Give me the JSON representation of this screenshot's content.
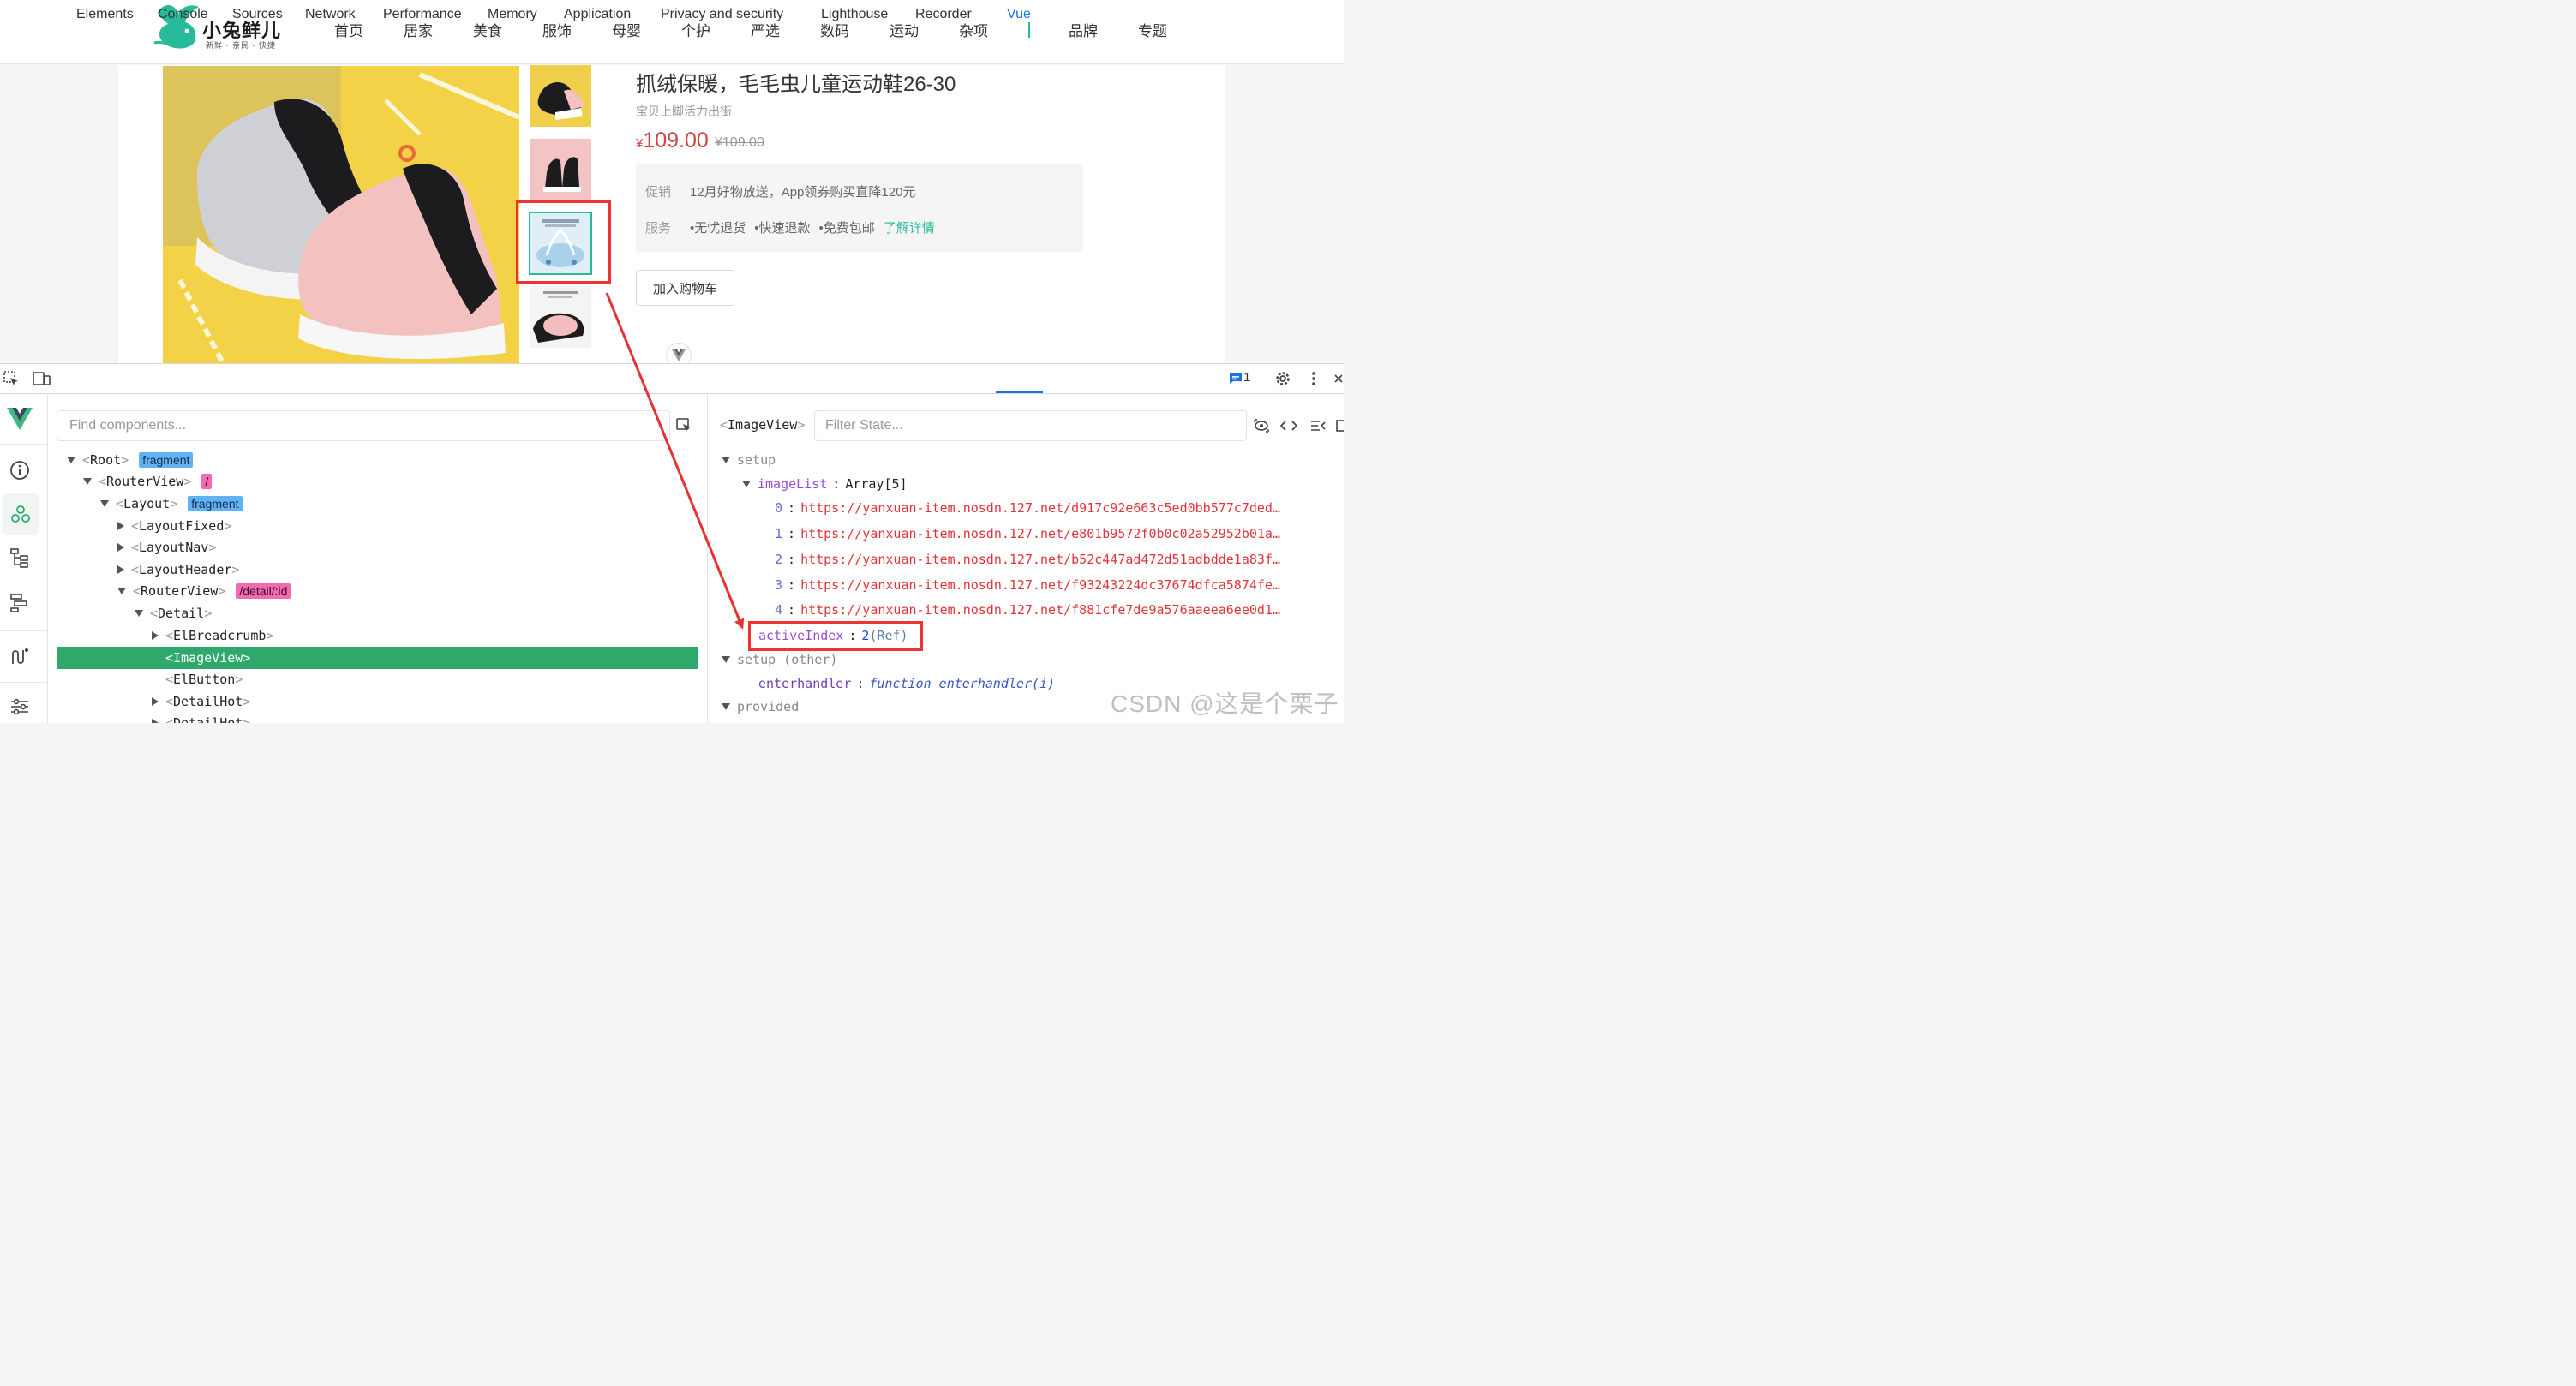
{
  "site": {
    "logo_text": "小兔鲜儿",
    "logo_sub": "新鲜 · 亲民 · 快捷",
    "nav": [
      "首页",
      "居家",
      "美食",
      "服饰",
      "母婴",
      "个护",
      "严选",
      "数码",
      "运动",
      "杂项"
    ],
    "nav_after": [
      "品牌",
      "专题"
    ]
  },
  "product": {
    "title": "抓绒保暖，毛毛虫儿童运动鞋26-30",
    "desc": "宝贝上脚活力出街",
    "currency": "¥",
    "price": "109.00",
    "old_price": "¥109.00",
    "promo_label": "促销",
    "promo_text": "12月好物放送，App领券购买直降120元",
    "service_label": "服务",
    "services": [
      "•无忧退货",
      "•快速退款",
      "•免费包邮"
    ],
    "service_link": "了解详情",
    "cart_button": "加入购物车",
    "thumbs": [
      "thumb-1",
      "thumb-2",
      "thumb-3",
      "thumb-4"
    ],
    "active_thumb": 2
  },
  "devtools": {
    "tabs": [
      "Elements",
      "Console",
      "Sources",
      "Network",
      "Performance",
      "Memory",
      "Application",
      "Privacy and security",
      "Lighthouse",
      "Recorder",
      "Vue"
    ],
    "active_tab": "Vue",
    "issue_count": "1",
    "search_placeholder": "Find components...",
    "filter_placeholder": "Filter State...",
    "selected_component": "ImageView",
    "tree": [
      {
        "name": "Root",
        "badge": "fragment",
        "badge_color": "blue",
        "caret": "down"
      },
      {
        "name": "RouterView",
        "badge": "/",
        "badge_color": "pink",
        "caret": "down"
      },
      {
        "name": "Layout",
        "badge": "fragment",
        "badge_color": "blue",
        "caret": "down"
      },
      {
        "name": "LayoutFixed",
        "badge": "",
        "caret": "right"
      },
      {
        "name": "LayoutNav",
        "badge": "",
        "caret": "right"
      },
      {
        "name": "LayoutHeader",
        "badge": "",
        "caret": "right"
      },
      {
        "name": "RouterView",
        "badge": "/detail/:id",
        "badge_color": "pink",
        "caret": "down"
      },
      {
        "name": "Detail",
        "badge": "",
        "caret": "down"
      },
      {
        "name": "ElBreadcrumb",
        "badge": "",
        "caret": "right"
      },
      {
        "name": "ImageView",
        "badge": "",
        "caret": "none"
      },
      {
        "name": "ElButton",
        "badge": "",
        "caret": "none"
      },
      {
        "name": "DetailHot",
        "badge": "",
        "caret": "right"
      },
      {
        "name": "DetailHot",
        "badge": "",
        "caret": "right"
      }
    ],
    "state": {
      "setup_label": "setup",
      "imageList_key": "imageList",
      "imageList_type": "Array[5]",
      "image_urls": [
        "https://yanxuan-item.nosdn.127.net/d917c92e663c5ed0bb577c7ded…",
        "https://yanxuan-item.nosdn.127.net/e801b9572f0b0c02a52952b01a…",
        "https://yanxuan-item.nosdn.127.net/b52c447ad472d51adbdde1a83f…",
        "https://yanxuan-item.nosdn.127.net/f93243224dc37674dfca5874fe…",
        "https://yanxuan-item.nosdn.127.net/f881cfe7de9a576aaeea6ee0d1…"
      ],
      "activeIndex_key": "activeIndex",
      "activeIndex_value": "2",
      "activeIndex_ref": "(Ref)",
      "setup_other_label": "setup (other)",
      "enterhandler_key": "enterhandler",
      "enterhandler_value": "function enterhandler(i)",
      "provided_label": "provided"
    }
  },
  "watermark": "CSDN @这是个栗子",
  "colors": {
    "brand": "#27ba9b",
    "price": "#cf4444",
    "vue_green": "#2ea96b",
    "devtools_blue": "#1a73e8",
    "annotation_red": "#e33333"
  }
}
